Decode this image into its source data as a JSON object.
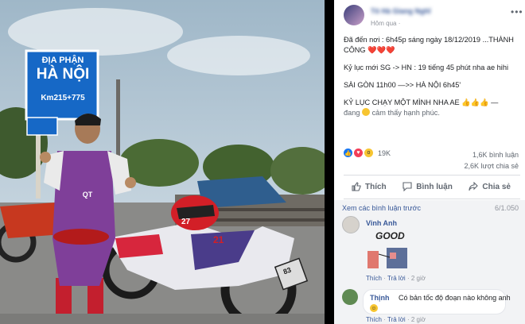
{
  "photo": {
    "sign_line1": "ĐỊA PHẬN",
    "sign_line2": "HÀ NỘI",
    "sign_line3": "Km215+775",
    "jersey": "QT",
    "plate": "83",
    "helmet_number": "27",
    "bike_number": "21"
  },
  "post": {
    "poster_name": "Tô Hà Giang Nghĩ",
    "time": "Hôm qua",
    "line1": "Đã đến nơi : 6h45p sáng ngày 18/12/2019 ...THÀNH CÔNG ❤️❤️❤️",
    "line2": "Kỷ lục mới SG -> HN : 19 tiếng 45 phút nha ae hihi",
    "line3": "SÀI GÒN 11h00 —>> HÀ NỘI 6h45'",
    "line4a": "KỶ LỤC CHẠY MỘT MÌNH NHA AE 👍👍👍 —",
    "line4b": "đang",
    "line4c": "cảm thấy hạnh phúc.",
    "reaction_count": "19K",
    "comments_count": "1,6K bình luận",
    "shares_count": "2,6K lượt chia sẻ",
    "like_label": "Thích",
    "comment_label": "Bình luận",
    "share_label": "Chia sẻ"
  },
  "comments": {
    "view_previous": "Xem các bình luận trước",
    "page_count": "6/1.050",
    "items": [
      {
        "name": "Vinh Anh",
        "sticker_text": "GOOD",
        "like": "Thích",
        "reply": "Trả lời",
        "time": "2 giờ"
      },
      {
        "name": "Thịnh",
        "text": "Có bản tốc độ đoạn nào không anh",
        "like": "Thích",
        "reply": "Trả lời",
        "time": "2 giờ"
      }
    ]
  },
  "colors": {
    "link": "#385898",
    "like_blue": "#1877f2",
    "heart": "#f33e58",
    "sign_blue": "#1668c6"
  }
}
